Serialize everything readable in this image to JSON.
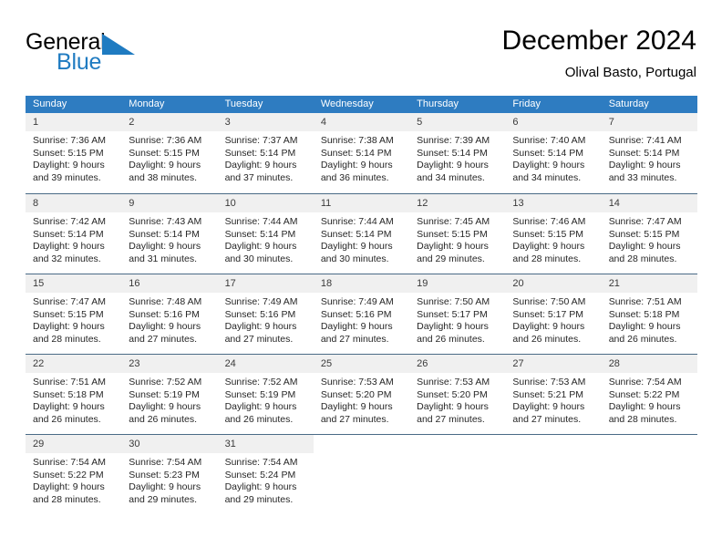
{
  "brand": {
    "name_part1": "General",
    "name_part2": "Blue",
    "triangle_icon": "triangle-icon",
    "accent_color": "#1f7bc1"
  },
  "header": {
    "title": "December 2024",
    "subtitle": "Olival Basto, Portugal"
  },
  "calendar": {
    "header_bg": "#2e7cc1",
    "day_band_bg": "#f0f0f0",
    "weekdays": [
      "Sunday",
      "Monday",
      "Tuesday",
      "Wednesday",
      "Thursday",
      "Friday",
      "Saturday"
    ],
    "weeks": [
      [
        {
          "day": "1",
          "sunrise": "Sunrise: 7:36 AM",
          "sunset": "Sunset: 5:15 PM",
          "daylight1": "Daylight: 9 hours",
          "daylight2": "and 39 minutes."
        },
        {
          "day": "2",
          "sunrise": "Sunrise: 7:36 AM",
          "sunset": "Sunset: 5:15 PM",
          "daylight1": "Daylight: 9 hours",
          "daylight2": "and 38 minutes."
        },
        {
          "day": "3",
          "sunrise": "Sunrise: 7:37 AM",
          "sunset": "Sunset: 5:14 PM",
          "daylight1": "Daylight: 9 hours",
          "daylight2": "and 37 minutes."
        },
        {
          "day": "4",
          "sunrise": "Sunrise: 7:38 AM",
          "sunset": "Sunset: 5:14 PM",
          "daylight1": "Daylight: 9 hours",
          "daylight2": "and 36 minutes."
        },
        {
          "day": "5",
          "sunrise": "Sunrise: 7:39 AM",
          "sunset": "Sunset: 5:14 PM",
          "daylight1": "Daylight: 9 hours",
          "daylight2": "and 34 minutes."
        },
        {
          "day": "6",
          "sunrise": "Sunrise: 7:40 AM",
          "sunset": "Sunset: 5:14 PM",
          "daylight1": "Daylight: 9 hours",
          "daylight2": "and 34 minutes."
        },
        {
          "day": "7",
          "sunrise": "Sunrise: 7:41 AM",
          "sunset": "Sunset: 5:14 PM",
          "daylight1": "Daylight: 9 hours",
          "daylight2": "and 33 minutes."
        }
      ],
      [
        {
          "day": "8",
          "sunrise": "Sunrise: 7:42 AM",
          "sunset": "Sunset: 5:14 PM",
          "daylight1": "Daylight: 9 hours",
          "daylight2": "and 32 minutes."
        },
        {
          "day": "9",
          "sunrise": "Sunrise: 7:43 AM",
          "sunset": "Sunset: 5:14 PM",
          "daylight1": "Daylight: 9 hours",
          "daylight2": "and 31 minutes."
        },
        {
          "day": "10",
          "sunrise": "Sunrise: 7:44 AM",
          "sunset": "Sunset: 5:14 PM",
          "daylight1": "Daylight: 9 hours",
          "daylight2": "and 30 minutes."
        },
        {
          "day": "11",
          "sunrise": "Sunrise: 7:44 AM",
          "sunset": "Sunset: 5:14 PM",
          "daylight1": "Daylight: 9 hours",
          "daylight2": "and 30 minutes."
        },
        {
          "day": "12",
          "sunrise": "Sunrise: 7:45 AM",
          "sunset": "Sunset: 5:15 PM",
          "daylight1": "Daylight: 9 hours",
          "daylight2": "and 29 minutes."
        },
        {
          "day": "13",
          "sunrise": "Sunrise: 7:46 AM",
          "sunset": "Sunset: 5:15 PM",
          "daylight1": "Daylight: 9 hours",
          "daylight2": "and 28 minutes."
        },
        {
          "day": "14",
          "sunrise": "Sunrise: 7:47 AM",
          "sunset": "Sunset: 5:15 PM",
          "daylight1": "Daylight: 9 hours",
          "daylight2": "and 28 minutes."
        }
      ],
      [
        {
          "day": "15",
          "sunrise": "Sunrise: 7:47 AM",
          "sunset": "Sunset: 5:15 PM",
          "daylight1": "Daylight: 9 hours",
          "daylight2": "and 28 minutes."
        },
        {
          "day": "16",
          "sunrise": "Sunrise: 7:48 AM",
          "sunset": "Sunset: 5:16 PM",
          "daylight1": "Daylight: 9 hours",
          "daylight2": "and 27 minutes."
        },
        {
          "day": "17",
          "sunrise": "Sunrise: 7:49 AM",
          "sunset": "Sunset: 5:16 PM",
          "daylight1": "Daylight: 9 hours",
          "daylight2": "and 27 minutes."
        },
        {
          "day": "18",
          "sunrise": "Sunrise: 7:49 AM",
          "sunset": "Sunset: 5:16 PM",
          "daylight1": "Daylight: 9 hours",
          "daylight2": "and 27 minutes."
        },
        {
          "day": "19",
          "sunrise": "Sunrise: 7:50 AM",
          "sunset": "Sunset: 5:17 PM",
          "daylight1": "Daylight: 9 hours",
          "daylight2": "and 26 minutes."
        },
        {
          "day": "20",
          "sunrise": "Sunrise: 7:50 AM",
          "sunset": "Sunset: 5:17 PM",
          "daylight1": "Daylight: 9 hours",
          "daylight2": "and 26 minutes."
        },
        {
          "day": "21",
          "sunrise": "Sunrise: 7:51 AM",
          "sunset": "Sunset: 5:18 PM",
          "daylight1": "Daylight: 9 hours",
          "daylight2": "and 26 minutes."
        }
      ],
      [
        {
          "day": "22",
          "sunrise": "Sunrise: 7:51 AM",
          "sunset": "Sunset: 5:18 PM",
          "daylight1": "Daylight: 9 hours",
          "daylight2": "and 26 minutes."
        },
        {
          "day": "23",
          "sunrise": "Sunrise: 7:52 AM",
          "sunset": "Sunset: 5:19 PM",
          "daylight1": "Daylight: 9 hours",
          "daylight2": "and 26 minutes."
        },
        {
          "day": "24",
          "sunrise": "Sunrise: 7:52 AM",
          "sunset": "Sunset: 5:19 PM",
          "daylight1": "Daylight: 9 hours",
          "daylight2": "and 26 minutes."
        },
        {
          "day": "25",
          "sunrise": "Sunrise: 7:53 AM",
          "sunset": "Sunset: 5:20 PM",
          "daylight1": "Daylight: 9 hours",
          "daylight2": "and 27 minutes."
        },
        {
          "day": "26",
          "sunrise": "Sunrise: 7:53 AM",
          "sunset": "Sunset: 5:20 PM",
          "daylight1": "Daylight: 9 hours",
          "daylight2": "and 27 minutes."
        },
        {
          "day": "27",
          "sunrise": "Sunrise: 7:53 AM",
          "sunset": "Sunset: 5:21 PM",
          "daylight1": "Daylight: 9 hours",
          "daylight2": "and 27 minutes."
        },
        {
          "day": "28",
          "sunrise": "Sunrise: 7:54 AM",
          "sunset": "Sunset: 5:22 PM",
          "daylight1": "Daylight: 9 hours",
          "daylight2": "and 28 minutes."
        }
      ],
      [
        {
          "day": "29",
          "sunrise": "Sunrise: 7:54 AM",
          "sunset": "Sunset: 5:22 PM",
          "daylight1": "Daylight: 9 hours",
          "daylight2": "and 28 minutes."
        },
        {
          "day": "30",
          "sunrise": "Sunrise: 7:54 AM",
          "sunset": "Sunset: 5:23 PM",
          "daylight1": "Daylight: 9 hours",
          "daylight2": "and 29 minutes."
        },
        {
          "day": "31",
          "sunrise": "Sunrise: 7:54 AM",
          "sunset": "Sunset: 5:24 PM",
          "daylight1": "Daylight: 9 hours",
          "daylight2": "and 29 minutes."
        },
        {
          "day": "",
          "sunrise": "",
          "sunset": "",
          "daylight1": "",
          "daylight2": ""
        },
        {
          "day": "",
          "sunrise": "",
          "sunset": "",
          "daylight1": "",
          "daylight2": ""
        },
        {
          "day": "",
          "sunrise": "",
          "sunset": "",
          "daylight1": "",
          "daylight2": ""
        },
        {
          "day": "",
          "sunrise": "",
          "sunset": "",
          "daylight1": "",
          "daylight2": ""
        }
      ]
    ]
  }
}
